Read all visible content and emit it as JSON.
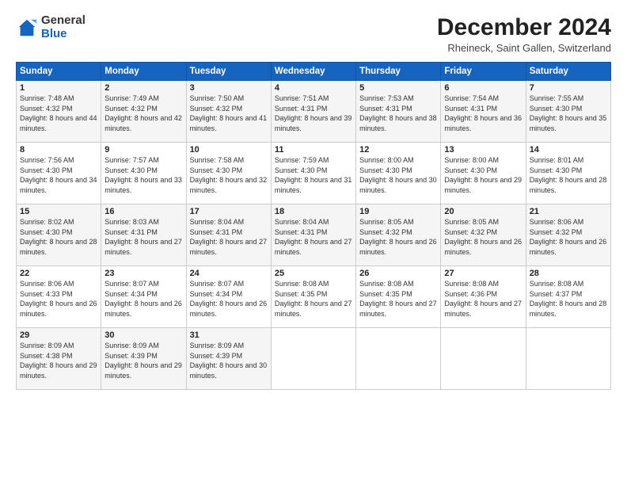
{
  "logo": {
    "general": "General",
    "blue": "Blue"
  },
  "title": "December 2024",
  "subtitle": "Rheineck, Saint Gallen, Switzerland",
  "headers": [
    "Sunday",
    "Monday",
    "Tuesday",
    "Wednesday",
    "Thursday",
    "Friday",
    "Saturday"
  ],
  "weeks": [
    [
      {
        "day": "1",
        "sunrise": "7:48 AM",
        "sunset": "4:32 PM",
        "daylight": "8 hours and 44 minutes."
      },
      {
        "day": "2",
        "sunrise": "7:49 AM",
        "sunset": "4:32 PM",
        "daylight": "8 hours and 42 minutes."
      },
      {
        "day": "3",
        "sunrise": "7:50 AM",
        "sunset": "4:32 PM",
        "daylight": "8 hours and 41 minutes."
      },
      {
        "day": "4",
        "sunrise": "7:51 AM",
        "sunset": "4:31 PM",
        "daylight": "8 hours and 39 minutes."
      },
      {
        "day": "5",
        "sunrise": "7:53 AM",
        "sunset": "4:31 PM",
        "daylight": "8 hours and 38 minutes."
      },
      {
        "day": "6",
        "sunrise": "7:54 AM",
        "sunset": "4:31 PM",
        "daylight": "8 hours and 36 minutes."
      },
      {
        "day": "7",
        "sunrise": "7:55 AM",
        "sunset": "4:30 PM",
        "daylight": "8 hours and 35 minutes."
      }
    ],
    [
      {
        "day": "8",
        "sunrise": "7:56 AM",
        "sunset": "4:30 PM",
        "daylight": "8 hours and 34 minutes."
      },
      {
        "day": "9",
        "sunrise": "7:57 AM",
        "sunset": "4:30 PM",
        "daylight": "8 hours and 33 minutes."
      },
      {
        "day": "10",
        "sunrise": "7:58 AM",
        "sunset": "4:30 PM",
        "daylight": "8 hours and 32 minutes."
      },
      {
        "day": "11",
        "sunrise": "7:59 AM",
        "sunset": "4:30 PM",
        "daylight": "8 hours and 31 minutes."
      },
      {
        "day": "12",
        "sunrise": "8:00 AM",
        "sunset": "4:30 PM",
        "daylight": "8 hours and 30 minutes."
      },
      {
        "day": "13",
        "sunrise": "8:00 AM",
        "sunset": "4:30 PM",
        "daylight": "8 hours and 29 minutes."
      },
      {
        "day": "14",
        "sunrise": "8:01 AM",
        "sunset": "4:30 PM",
        "daylight": "8 hours and 28 minutes."
      }
    ],
    [
      {
        "day": "15",
        "sunrise": "8:02 AM",
        "sunset": "4:30 PM",
        "daylight": "8 hours and 28 minutes."
      },
      {
        "day": "16",
        "sunrise": "8:03 AM",
        "sunset": "4:31 PM",
        "daylight": "8 hours and 27 minutes."
      },
      {
        "day": "17",
        "sunrise": "8:04 AM",
        "sunset": "4:31 PM",
        "daylight": "8 hours and 27 minutes."
      },
      {
        "day": "18",
        "sunrise": "8:04 AM",
        "sunset": "4:31 PM",
        "daylight": "8 hours and 27 minutes."
      },
      {
        "day": "19",
        "sunrise": "8:05 AM",
        "sunset": "4:32 PM",
        "daylight": "8 hours and 26 minutes."
      },
      {
        "day": "20",
        "sunrise": "8:05 AM",
        "sunset": "4:32 PM",
        "daylight": "8 hours and 26 minutes."
      },
      {
        "day": "21",
        "sunrise": "8:06 AM",
        "sunset": "4:32 PM",
        "daylight": "8 hours and 26 minutes."
      }
    ],
    [
      {
        "day": "22",
        "sunrise": "8:06 AM",
        "sunset": "4:33 PM",
        "daylight": "8 hours and 26 minutes."
      },
      {
        "day": "23",
        "sunrise": "8:07 AM",
        "sunset": "4:34 PM",
        "daylight": "8 hours and 26 minutes."
      },
      {
        "day": "24",
        "sunrise": "8:07 AM",
        "sunset": "4:34 PM",
        "daylight": "8 hours and 26 minutes."
      },
      {
        "day": "25",
        "sunrise": "8:08 AM",
        "sunset": "4:35 PM",
        "daylight": "8 hours and 27 minutes."
      },
      {
        "day": "26",
        "sunrise": "8:08 AM",
        "sunset": "4:35 PM",
        "daylight": "8 hours and 27 minutes."
      },
      {
        "day": "27",
        "sunrise": "8:08 AM",
        "sunset": "4:36 PM",
        "daylight": "8 hours and 27 minutes."
      },
      {
        "day": "28",
        "sunrise": "8:08 AM",
        "sunset": "4:37 PM",
        "daylight": "8 hours and 28 minutes."
      }
    ],
    [
      {
        "day": "29",
        "sunrise": "8:09 AM",
        "sunset": "4:38 PM",
        "daylight": "8 hours and 29 minutes."
      },
      {
        "day": "30",
        "sunrise": "8:09 AM",
        "sunset": "4:39 PM",
        "daylight": "8 hours and 29 minutes."
      },
      {
        "day": "31",
        "sunrise": "8:09 AM",
        "sunset": "4:39 PM",
        "daylight": "8 hours and 30 minutes."
      },
      null,
      null,
      null,
      null
    ]
  ],
  "labels": {
    "sunrise": "Sunrise:",
    "sunset": "Sunset:",
    "daylight": "Daylight:"
  }
}
